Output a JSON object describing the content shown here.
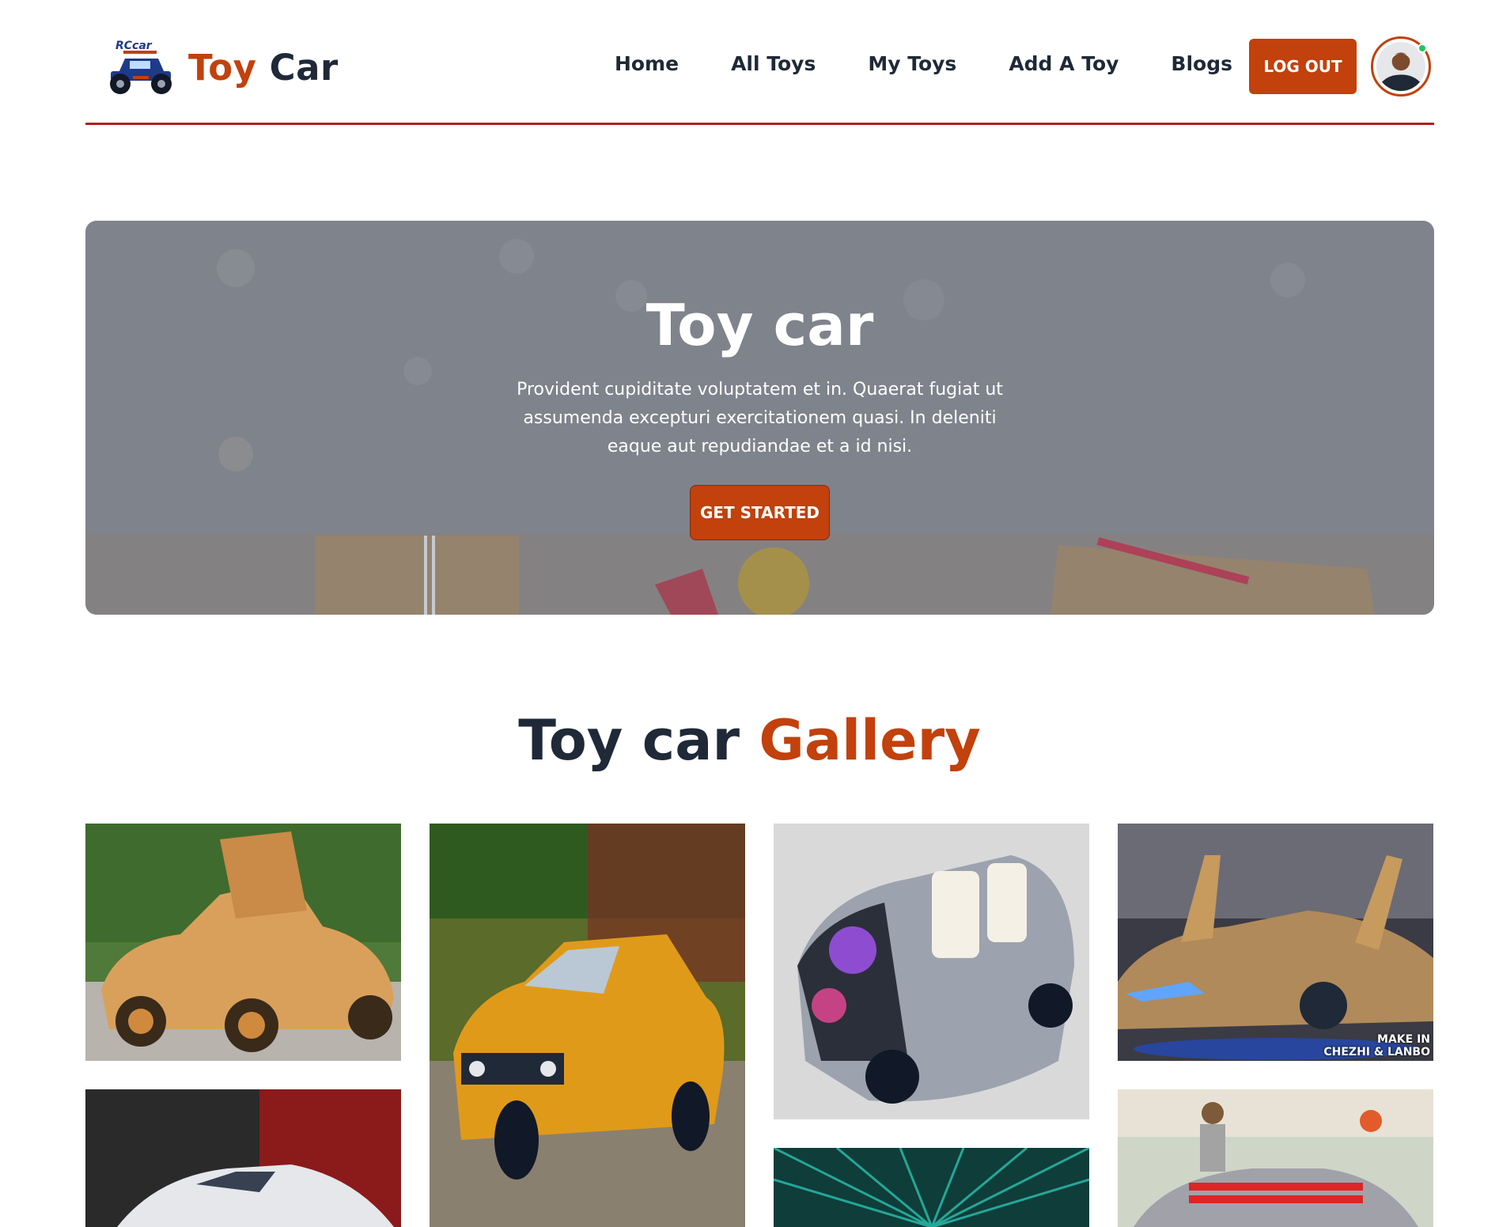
{
  "navbar": {
    "logo_icon": "rc-car-logo",
    "brand_accent": "Toy",
    "brand_rest": "Car",
    "links": [
      "Home",
      "All Toys",
      "My Toys",
      "Add A Toy",
      "Blogs"
    ],
    "logout_label": "LOG OUT",
    "avatar_icon": "user-avatar"
  },
  "hero": {
    "title": "Toy car",
    "text": "Provident cupiditate voluptatem et in. Quaerat fugiat ut assumenda excepturi exercitationem quasi. In deleniti eaque aut repudiandae et a id nisi.",
    "button_label": "GET STARTED"
  },
  "gallery": {
    "heading_dark": "Toy car",
    "heading_accent": "Gallery",
    "tiles": [
      {
        "subject": "wooden sports car"
      },
      {
        "subject": "yellow classic toy car"
      },
      {
        "subject": "silver concept car with flower artwork"
      },
      {
        "subject": "golden supercar",
        "caption": [
          "MAKE IN",
          "CHEZHI & LANBO"
        ]
      },
      {
        "subject": "white supercar in red garage"
      },
      {
        "subject": "teal light tunnel"
      },
      {
        "subject": "silver car with red stripes at expo"
      }
    ]
  },
  "colors": {
    "accent": "#c2410c",
    "dark_text": "#1f2937",
    "nav_border": "#b91c1c",
    "online": "#22c55e"
  }
}
